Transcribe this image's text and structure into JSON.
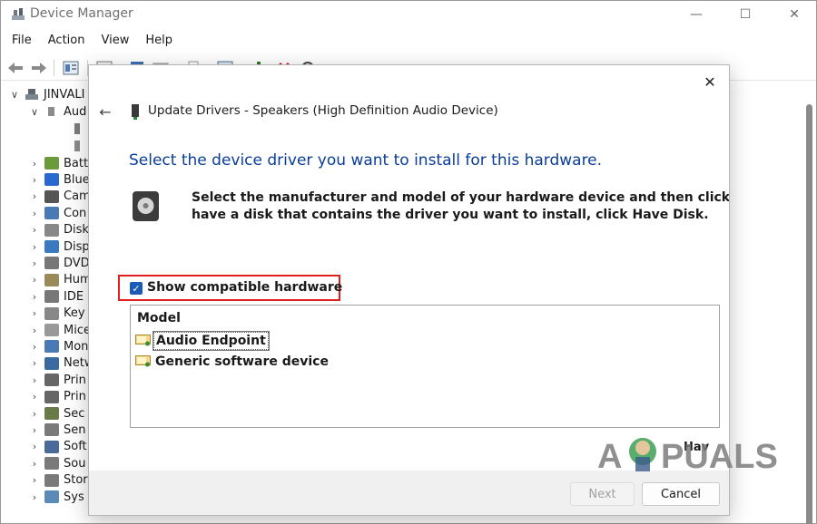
{
  "window": {
    "title": "Device Manager",
    "controls": {
      "minimize": "—",
      "maximize": "☐",
      "close": "✕"
    }
  },
  "menu": [
    "File",
    "Action",
    "View",
    "Help"
  ],
  "tree": {
    "root": "JINVALI",
    "expanded_category": "Aud",
    "categories": [
      "Batt",
      "Blue",
      "Cam",
      "Con",
      "Disk",
      "Disp",
      "DVD",
      "Hum",
      "IDE",
      "Key",
      "Mice",
      "Mon",
      "Netw",
      "Prin",
      "Prin",
      "Sec",
      "Sen",
      "Soft",
      "Sou",
      "Stor",
      "Sys"
    ]
  },
  "dialog": {
    "title": "Update Drivers - Speakers (High Definition Audio Device)",
    "heading": "Select the device driver you want to install for this hardware.",
    "instructions_line1": "Select the manufacturer and model of your hardware device and then click Ne",
    "instructions_line2": "have a disk that contains the driver you want to install, click Have Disk.",
    "show_compatible_label": "Show compatible hardware",
    "show_compatible_checked": true,
    "model_header": "Model",
    "models": [
      "Audio Endpoint",
      "Generic software device"
    ],
    "selected_model": "Audio Endpoint",
    "have_disk_label": "Hav",
    "next_label": "Next",
    "cancel_label": "Cancel"
  },
  "watermark": {
    "text_a": "A",
    "text_puals": "PUALS"
  },
  "colors": {
    "heading": "#0a3d9a",
    "checkbox": "#1a5bb8",
    "highlight_box": "#e02020"
  }
}
